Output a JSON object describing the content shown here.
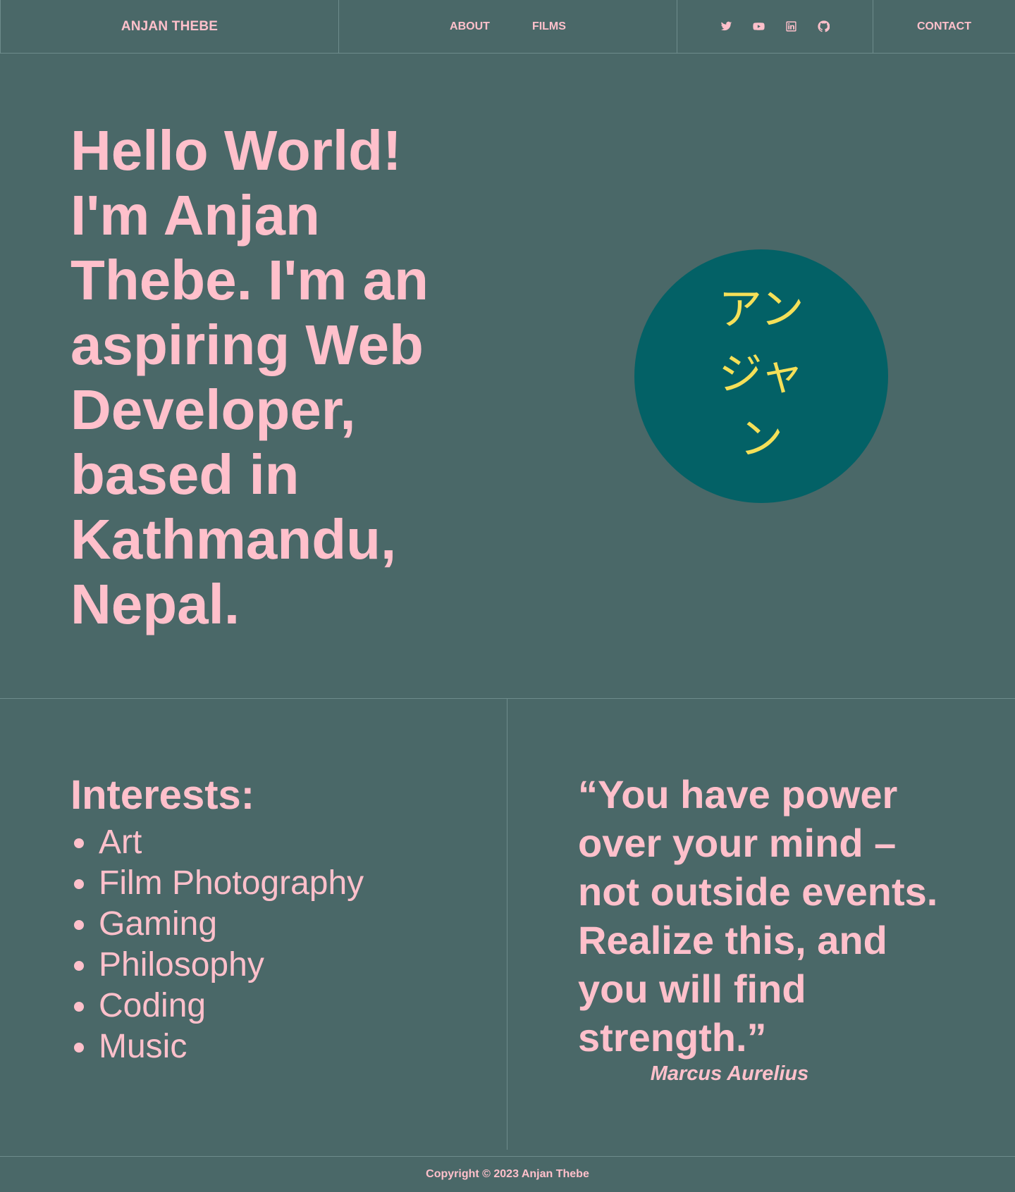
{
  "nav": {
    "brand": "ANJAN THEBE",
    "links": [
      {
        "label": "ABOUT"
      },
      {
        "label": "FILMS"
      }
    ],
    "social_icons": [
      "twitter-icon",
      "youtube-icon",
      "linkedin-icon",
      "github-icon"
    ],
    "contact": "CONTACT"
  },
  "hero": {
    "intro": "Hello World! I'm Anjan Thebe. I'm an aspiring Web Developer, based in Kathmandu, Nepal.",
    "katakana": "アンジャン"
  },
  "interests": {
    "heading": "Interests:",
    "items": [
      "Art",
      "Film Photography",
      "Gaming",
      "Philosophy",
      "Coding",
      "Music"
    ]
  },
  "quote": {
    "text": " “You have power over your mind – not outside events. Realize this, and you will find strength.”",
    "author": "Marcus Aurelius"
  },
  "footer": {
    "copyright": "Copyright © 2023 Anjan Thebe"
  },
  "colors": {
    "background": "#4a6868",
    "text": "#ffc0cb",
    "circle": "#036166",
    "circle_text": "#f5e058",
    "lines": "#6e8c8c"
  }
}
